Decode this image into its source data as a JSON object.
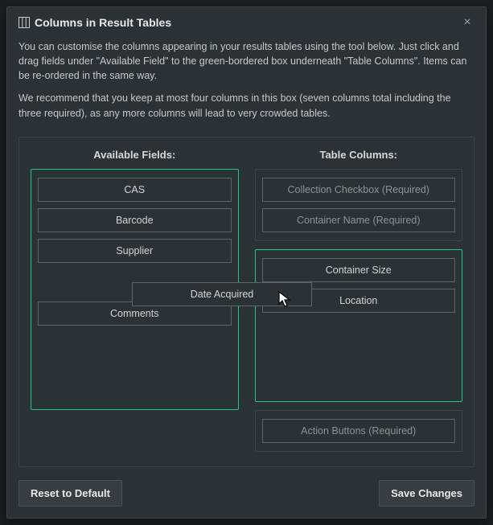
{
  "header": {
    "title": "Columns in Result Tables"
  },
  "description": {
    "p1": "You can customise the columns appearing in your results tables using the tool below. Just click and drag fields under \"Available Field\" to the green-bordered box underneath \"Table Columns\". Items can be re-ordered in the same way.",
    "p2": "We recommend that you keep at most four columns in this box (seven columns total including the three required), as any more columns will lead to very crowded tables."
  },
  "columns": {
    "available_heading": "Available Fields:",
    "table_heading": "Table Columns:",
    "available": {
      "items": [
        "CAS",
        "Barcode",
        "Supplier",
        "Comments"
      ]
    },
    "required_top": [
      "Collection Checkbox (Required)",
      "Container Name (Required)"
    ],
    "configurable": [
      "Container Size",
      "Location"
    ],
    "required_bottom": [
      "Action Buttons (Required)"
    ]
  },
  "drag": {
    "label": "Date Acquired"
  },
  "footer": {
    "reset": "Reset to Default",
    "save": "Save Changes"
  }
}
